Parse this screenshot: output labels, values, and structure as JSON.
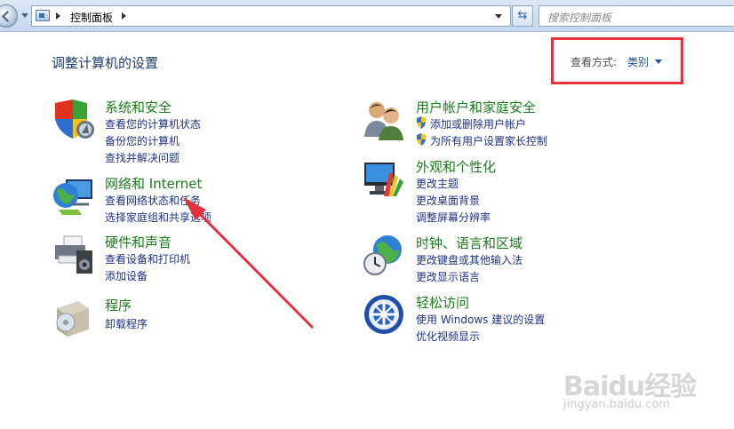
{
  "address_bar": {
    "path": "控制面板",
    "search_placeholder": "搜索控制面板"
  },
  "header": {
    "title": "调整计算机的设置",
    "view_label": "查看方式:",
    "view_value": "类别"
  },
  "categories": [
    {
      "title": "系统和安全",
      "icon": "shield-computer-icon",
      "links": [
        "查看您的计算机状态",
        "备份您的计算机",
        "查找并解决问题"
      ]
    },
    {
      "title": "网络和 Internet",
      "icon": "globe-network-icon",
      "links": [
        "查看网络状态和任务",
        "选择家庭组和共享选项"
      ]
    },
    {
      "title": "硬件和声音",
      "icon": "printer-speaker-icon",
      "links": [
        "查看设备和打印机",
        "添加设备"
      ]
    },
    {
      "title": "程序",
      "icon": "program-box-icon",
      "links": [
        "卸载程序"
      ]
    },
    {
      "title": "用户帐户和家庭安全",
      "icon": "users-icon",
      "links": [
        "添加或删除用户帐户",
        "为所有用户设置家长控制"
      ]
    },
    {
      "title": "外观和个性化",
      "icon": "monitor-palette-icon",
      "links": [
        "更改主题",
        "更改桌面背景",
        "调整屏幕分辨率"
      ]
    },
    {
      "title": "时钟、语言和区域",
      "icon": "globe-clock-icon",
      "links": [
        "更改键盘或其他输入法",
        "更改显示语言"
      ]
    },
    {
      "title": "轻松访问",
      "icon": "accessibility-icon",
      "links": [
        "使用 Windows 建议的设置",
        "优化视频显示"
      ]
    }
  ],
  "watermark": {
    "logo": "Baidu经验",
    "url": "jingyan.baidu.com"
  },
  "colors": {
    "category_title": "#1b7d1b",
    "link": "#1e3287",
    "highlight_box": "#e23240",
    "arrow": "#e23240"
  }
}
